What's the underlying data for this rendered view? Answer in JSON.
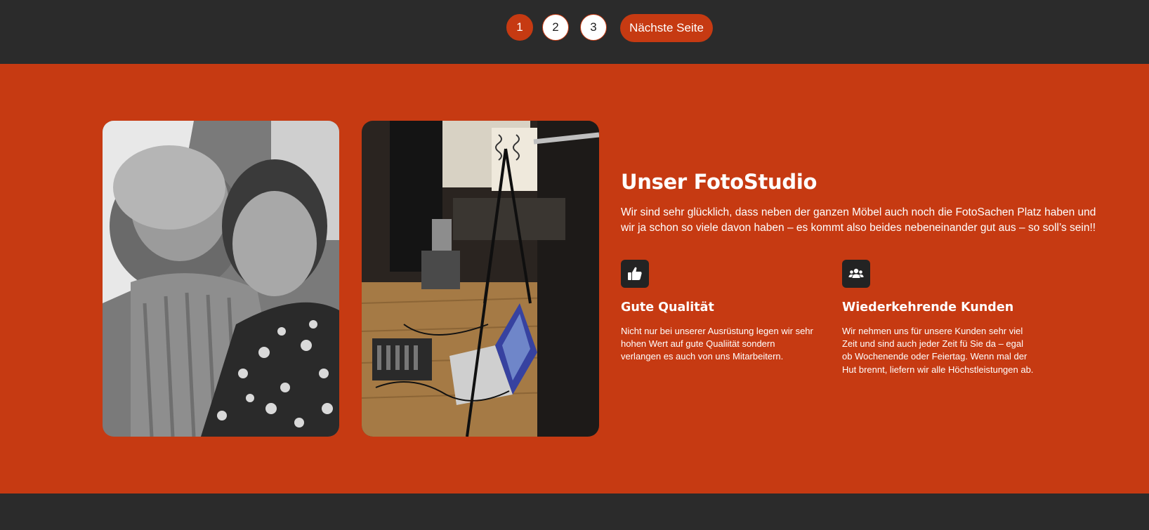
{
  "pagination": {
    "pages": [
      "1",
      "2",
      "3"
    ],
    "current": "1",
    "next_label": "Nächste Seite"
  },
  "section": {
    "heading": "Unser FotoStudio",
    "intro": "Wir sind sehr glücklich, dass neben der ganzen Möbel auch noch die FotoSachen Platz haben und wir ja schon so viele davon haben – es kommt also beides nebeneinander gut aus – so soll’s sein!!",
    "features": [
      {
        "icon": "thumbs-up-icon",
        "title": "Gute Qualität",
        "text": "Nicht nur bei unserer Ausrüstung legen wir sehr hohen Wert auf gute Qualiität sondern verlangen es auch von uns Mitarbeitern."
      },
      {
        "icon": "users-icon",
        "title": "Wiederkehrende Kunden",
        "text": "Wir nehmen uns für unsere Kunden sehr viel Zeit und sind auch jeder Zeit fü Sie da – egal ob Wochenende oder Feiertag. Wenn mal der Hut brennt, liefern wir alle Höchstleistungen ab."
      }
    ]
  },
  "colors": {
    "accent": "#c63a12",
    "dark": "#2b2b2b",
    "icon_bg": "#232323",
    "text": "#ffffff"
  }
}
